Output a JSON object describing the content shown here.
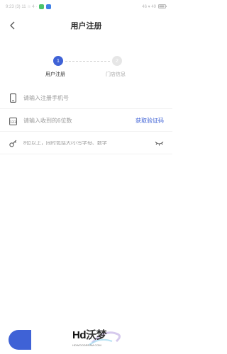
{
  "status_bar": {
    "left_text": "9:23 (3) 11 ☆ 4 ·",
    "right_text": "46 ▾ 49"
  },
  "colors": {
    "accent": "#3f62d6",
    "inactive_step": "#e6e6e6",
    "placeholder": "#9a9a9a"
  },
  "header": {
    "title": "用户注册",
    "back_icon": "chevron-left-icon"
  },
  "steps": [
    {
      "number": "1",
      "label": "用户注册",
      "active": true
    },
    {
      "number": "2",
      "label": "门店信息",
      "active": false
    }
  ],
  "form": {
    "phone": {
      "placeholder": "请输入注册手机号",
      "value": "",
      "icon": "phone-icon"
    },
    "code": {
      "placeholder": "请输入收到的6位数",
      "value": "",
      "icon": "verification-code-icon",
      "action_label": "获取验证码"
    },
    "password": {
      "placeholder": "8位以上，同时包括大/小写字母、数字",
      "value": "",
      "icon": "key-icon",
      "toggle_icon": "eye-closed-icon"
    }
  },
  "watermark": {
    "title_latin": "Hd",
    "title_cn": "沃梦",
    "subtitle": "HDWOODREAM.COM"
  }
}
